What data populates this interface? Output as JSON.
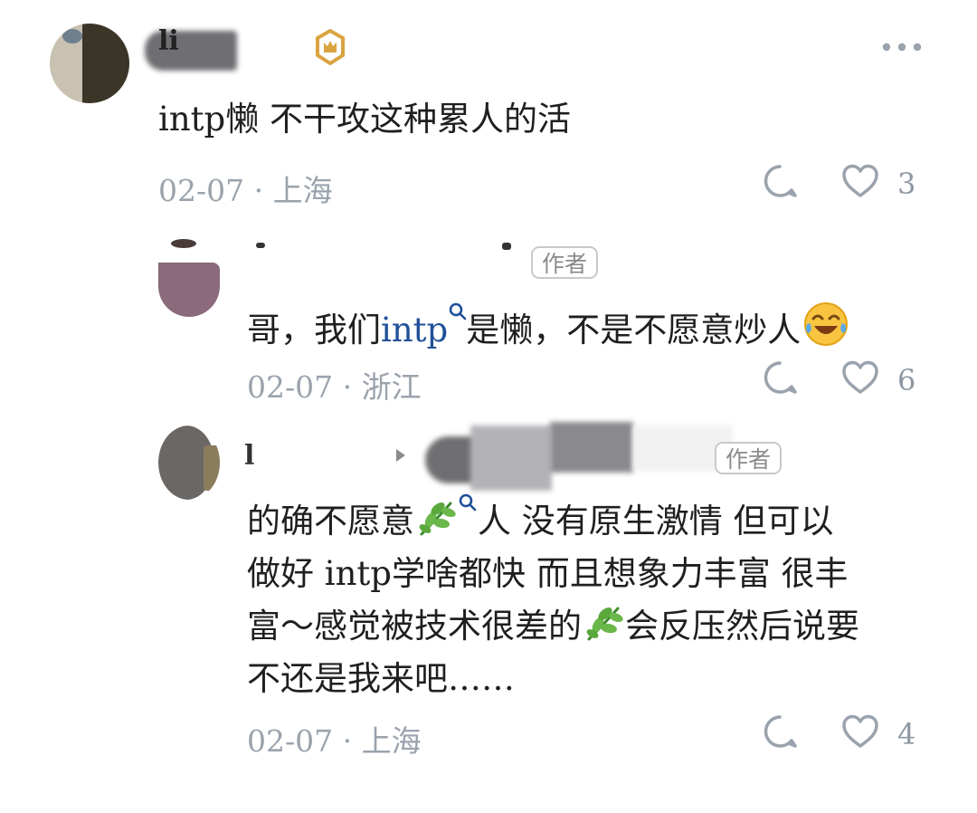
{
  "comments": [
    {
      "username": "li",
      "badge_icon": "crown-badge-icon",
      "text": "intp懒 不干攻这种累人的活",
      "date": "02-07",
      "location": "上海",
      "likes": "3"
    },
    {
      "author_label": "作者",
      "text_prefix": "哥，我们",
      "link_text": "intp",
      "text_suffix": "是懒，不是不愿意炒人",
      "emoji": "laughing-crying-emoji",
      "date": "02-07",
      "location": "浙江",
      "likes": "6"
    },
    {
      "username": "l",
      "author_label": "作者",
      "line1_a": "的确不愿意",
      "line1_b": "人 没有原生激情 但可以",
      "line2": "做好 intp学啥都快 而且想象力丰富 很丰",
      "line3_a": "富～感觉被技术很差的",
      "line3_b": "会反压然后说要",
      "line4": "不还是我来吧……",
      "date": "02-07",
      "location": "上海",
      "likes": "4"
    }
  ],
  "more_icon": "more-dots-icon",
  "meta_separator": "·",
  "colors": {
    "link": "#1f4f98",
    "meta": "#9aa3ad",
    "badge": "#d9a441"
  }
}
